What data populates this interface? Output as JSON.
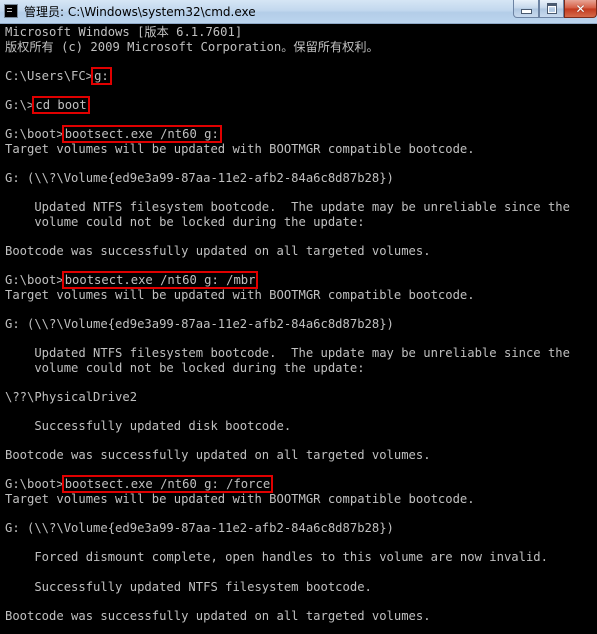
{
  "window": {
    "title": "管理员: C:\\Windows\\system32\\cmd.exe",
    "minimize_glyph": "",
    "close_glyph": "✕"
  },
  "console": {
    "lines": [
      {
        "prefix": "Microsoft Windows [版本 6.1.7601]",
        "cmd": ""
      },
      {
        "prefix": "版权所有 (c) 2009 Microsoft Corporation。保留所有权利。",
        "cmd": ""
      },
      {
        "prefix": "",
        "cmd": ""
      },
      {
        "prefix": "C:\\Users\\FC>",
        "cmd": "g:"
      },
      {
        "prefix": "",
        "cmd": ""
      },
      {
        "prefix": "G:\\>",
        "cmd": "cd boot"
      },
      {
        "prefix": "",
        "cmd": ""
      },
      {
        "prefix": "G:\\boot>",
        "cmd": "bootsect.exe /nt60 g:"
      },
      {
        "prefix": "Target volumes will be updated with BOOTMGR compatible bootcode.",
        "cmd": ""
      },
      {
        "prefix": "",
        "cmd": ""
      },
      {
        "prefix": "G: (\\\\?\\Volume{ed9e3a99-87aa-11e2-afb2-84a6c8d87b28})",
        "cmd": ""
      },
      {
        "prefix": "",
        "cmd": ""
      },
      {
        "prefix": "    Updated NTFS filesystem bootcode.  The update may be unreliable since the",
        "cmd": ""
      },
      {
        "prefix": "    volume could not be locked during the update:",
        "cmd": ""
      },
      {
        "prefix": "",
        "cmd": ""
      },
      {
        "prefix": "Bootcode was successfully updated on all targeted volumes.",
        "cmd": ""
      },
      {
        "prefix": "",
        "cmd": ""
      },
      {
        "prefix": "G:\\boot>",
        "cmd": "bootsect.exe /nt60 g: /mbr"
      },
      {
        "prefix": "Target volumes will be updated with BOOTMGR compatible bootcode.",
        "cmd": ""
      },
      {
        "prefix": "",
        "cmd": ""
      },
      {
        "prefix": "G: (\\\\?\\Volume{ed9e3a99-87aa-11e2-afb2-84a6c8d87b28})",
        "cmd": ""
      },
      {
        "prefix": "",
        "cmd": ""
      },
      {
        "prefix": "    Updated NTFS filesystem bootcode.  The update may be unreliable since the",
        "cmd": ""
      },
      {
        "prefix": "    volume could not be locked during the update:",
        "cmd": ""
      },
      {
        "prefix": "",
        "cmd": ""
      },
      {
        "prefix": "\\??\\PhysicalDrive2",
        "cmd": ""
      },
      {
        "prefix": "",
        "cmd": ""
      },
      {
        "prefix": "    Successfully updated disk bootcode.",
        "cmd": ""
      },
      {
        "prefix": "",
        "cmd": ""
      },
      {
        "prefix": "Bootcode was successfully updated on all targeted volumes.",
        "cmd": ""
      },
      {
        "prefix": "",
        "cmd": ""
      },
      {
        "prefix": "G:\\boot>",
        "cmd": "bootsect.exe /nt60 g: /force"
      },
      {
        "prefix": "Target volumes will be updated with BOOTMGR compatible bootcode.",
        "cmd": ""
      },
      {
        "prefix": "",
        "cmd": ""
      },
      {
        "prefix": "G: (\\\\?\\Volume{ed9e3a99-87aa-11e2-afb2-84a6c8d87b28})",
        "cmd": ""
      },
      {
        "prefix": "",
        "cmd": ""
      },
      {
        "prefix": "    Forced dismount complete, open handles to this volume are now invalid.",
        "cmd": ""
      },
      {
        "prefix": "",
        "cmd": ""
      },
      {
        "prefix": "    Successfully updated NTFS filesystem bootcode.",
        "cmd": ""
      },
      {
        "prefix": "",
        "cmd": ""
      },
      {
        "prefix": "Bootcode was successfully updated on all targeted volumes.",
        "cmd": ""
      }
    ]
  },
  "colors": {
    "background": "#000000",
    "text": "#c0c0c0",
    "highlight_box": "#e00000"
  }
}
